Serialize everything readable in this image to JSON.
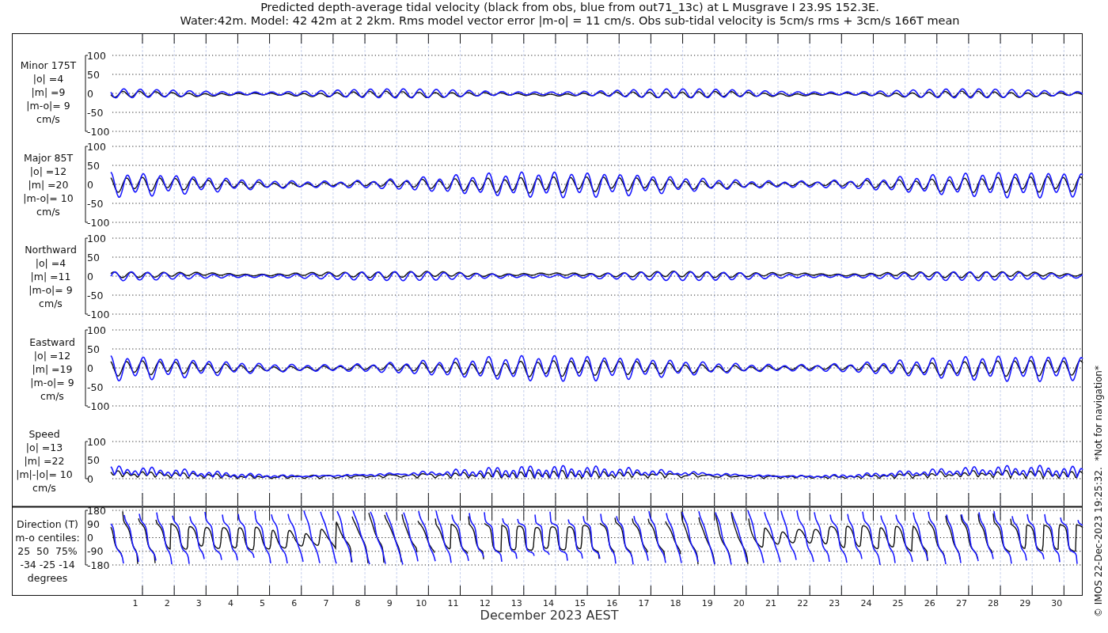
{
  "title_lines": [
    "Predicted depth-average tidal velocity (black from obs, blue from out71_13c) at L Musgrave I 23.9S 152.3E.",
    "Water:42m. Model: 42 42m at 2 2km. Rms model vector error |m-o| = 11 cm/s. Obs sub-tidal velocity is 5cm/s rms + 3cm/s 166T mean"
  ],
  "panels": [
    {
      "kind": "minor",
      "label_lines": [
        "Minor 175T",
        "|o| =4",
        "|m| =9",
        "|m-o|= 9",
        "cm/s"
      ],
      "yticks": [
        "100",
        "50",
        "0",
        "-50",
        "-100"
      ]
    },
    {
      "kind": "major",
      "label_lines": [
        "Major 85T",
        "|o| =12",
        "|m| =20",
        "|m-o|= 10",
        "cm/s"
      ],
      "yticks": [
        "100",
        "50",
        "0",
        "-50",
        "-100"
      ]
    },
    {
      "kind": "north",
      "label_lines": [
        "Northward",
        "|o| =4",
        "|m| =11",
        "|m-o|= 9",
        "cm/s"
      ],
      "yticks": [
        "100",
        "50",
        "0",
        "-50",
        "-100"
      ]
    },
    {
      "kind": "east",
      "label_lines": [
        "Eastward",
        "|o| =12",
        "|m| =19",
        "|m-o|= 9",
        "cm/s"
      ],
      "yticks": [
        "100",
        "50",
        "0",
        "-50",
        "-100"
      ]
    },
    {
      "kind": "speed",
      "label_lines": [
        "Speed",
        "|o| =13",
        "|m| =22",
        "|m|-|o|= 10",
        "cm/s"
      ],
      "yticks": [
        "100",
        "50",
        "0"
      ]
    },
    {
      "kind": "direction",
      "label_lines": [
        "Direction (T)",
        "m-o centiles:",
        "25  50  75%",
        "-34 -25 -14",
        "degrees"
      ],
      "yticks": [
        "180",
        "90",
        "0",
        "-90",
        "-180"
      ]
    }
  ],
  "x_labels": [
    "1",
    "2",
    "3",
    "4",
    "5",
    "6",
    "7",
    "8",
    "9",
    "10",
    "11",
    "12",
    "13",
    "14",
    "15",
    "16",
    "17",
    "18",
    "19",
    "20",
    "21",
    "22",
    "23",
    "24",
    "25",
    "26",
    "27",
    "28",
    "29",
    "30"
  ],
  "xlabel": "December 2023 AEST",
  "side_note": "© IMOS 22-Dec-2023 19:25:32.  *Not for navigation*"
}
